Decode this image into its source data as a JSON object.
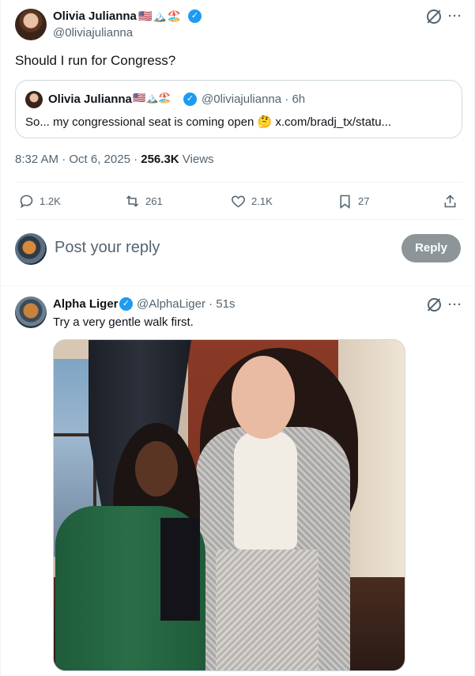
{
  "tweet": {
    "author_name": "Olivia Julianna",
    "author_flags": "🇺🇸🏔️🏖️",
    "author_handle": "@0liviajulianna",
    "text": "Should I run for Congress?",
    "quote": {
      "author_name": "Olivia Julianna",
      "author_flags": "🇺🇸🏔️🏖️",
      "handle_time": "@0liviajulianna · 6h",
      "text": "So... my congressional seat is coming open 🤔 x.com/bradj_tx/statu..."
    },
    "meta": {
      "time_date": "8:32 AM · Oct 6, 2025 · ",
      "views_count": "256.3K",
      "views_label": " Views"
    },
    "actions": {
      "replies": "1.2K",
      "reposts": "261",
      "likes": "2.1K",
      "bookmarks": "27"
    },
    "more_icon": "···"
  },
  "composer": {
    "placeholder": "Post your reply",
    "button_label": "Reply"
  },
  "reply": {
    "author_name": "Alpha Liger",
    "handle_time": "@AlphaLiger · 51s",
    "text": "Try a very gentle walk first.",
    "more_icon": "···"
  },
  "colors": {
    "verified": "#1d9bf0",
    "muted_text": "#536471",
    "reply_button_disabled": "#8d9599"
  },
  "icons": {
    "reply": "reply-icon",
    "repost": "repost-icon",
    "like": "heart-icon",
    "bookmark": "bookmark-icon",
    "share": "share-icon",
    "grok": "grok-icon"
  }
}
